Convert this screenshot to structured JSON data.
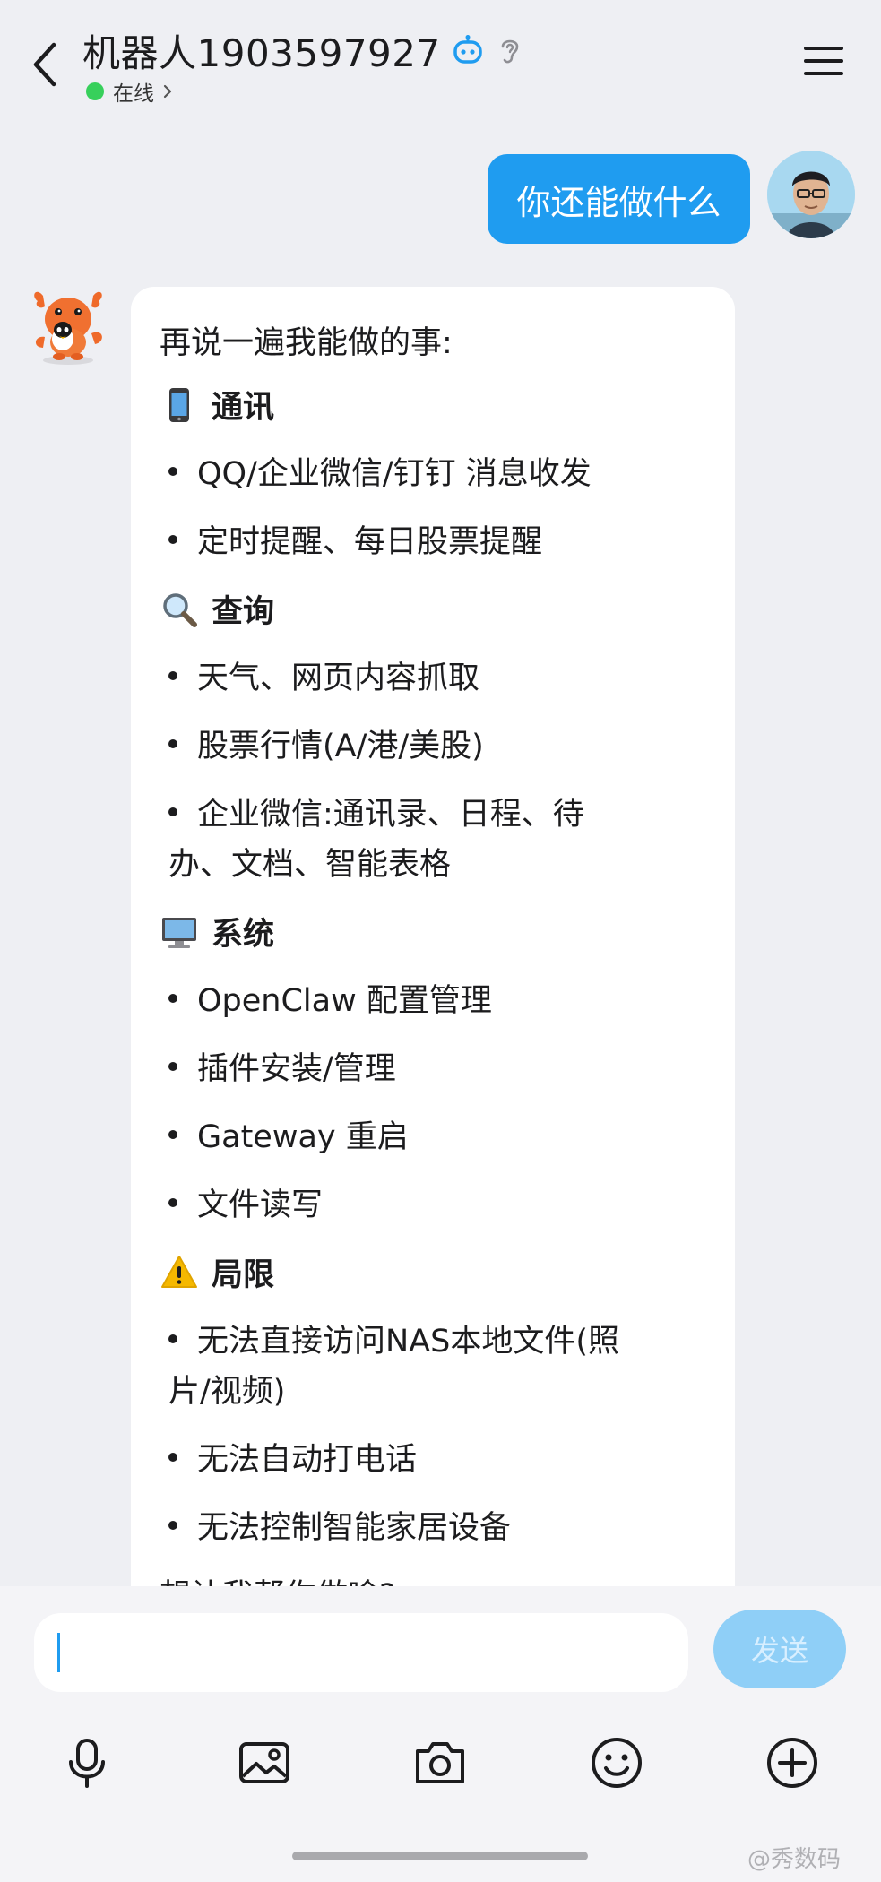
{
  "header": {
    "title": "机器人1903597927",
    "status": "在线"
  },
  "messages": {
    "user_text": "你还能做什么",
    "bot": {
      "intro": "再说一遍我能做的事:",
      "sections": [
        {
          "icon": "phone-emoji-icon",
          "title": "通讯",
          "items": [
            "QQ/企业微信/钉钉 消息收发",
            "定时提醒、每日股票提醒"
          ]
        },
        {
          "icon": "magnifier-emoji-icon",
          "title": "查询",
          "items": [
            "天气、网页内容抓取",
            "股票行情(A/港/美股)",
            "企业微信:通讯录、日程、待",
            "办、文档、智能表格"
          ]
        },
        {
          "icon": "computer-emoji-icon",
          "title": "系统",
          "items": [
            "OpenClaw 配置管理",
            "插件安装/管理",
            "Gateway 重启",
            "文件读写"
          ]
        },
        {
          "icon": "warning-emoji-icon",
          "title": "局限",
          "items": [
            "无法直接访问NAS本地文件(照",
            "片/视频)",
            "无法自动打电话",
            "无法控制智能家居设备"
          ]
        }
      ],
      "outro": "想让我帮你做啥?"
    }
  },
  "composer": {
    "value": "",
    "send_label": "发送"
  },
  "watermark": "@秀数码",
  "colors": {
    "accent": "#1f9cf0",
    "online": "#37d05b",
    "send_disabled": "#8fcff7",
    "background": "#eeeff3"
  }
}
